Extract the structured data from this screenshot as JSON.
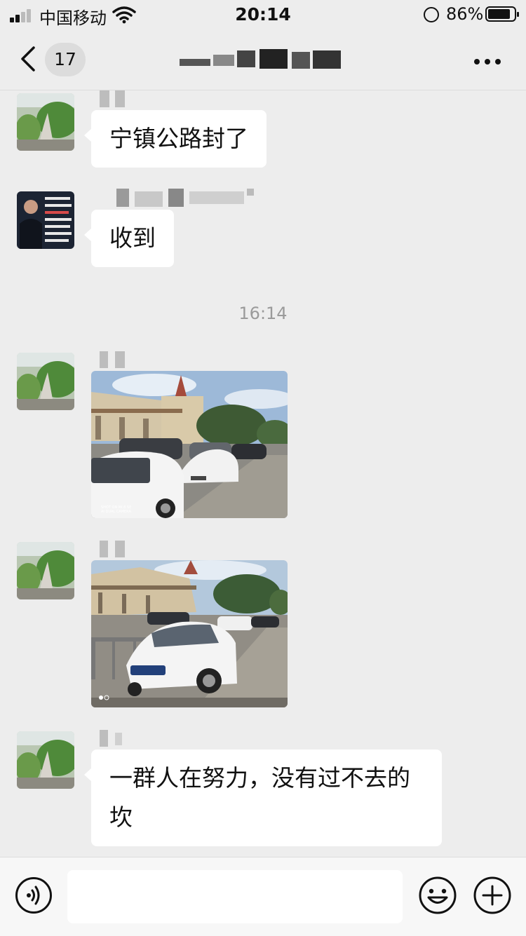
{
  "status_bar": {
    "carrier": "中国移动",
    "time": "20:14",
    "battery_percent": "86%",
    "battery_level": 0.86
  },
  "nav": {
    "unread_count": "17",
    "icons": [
      "chevron-left-icon",
      "more-icon"
    ]
  },
  "messages": [
    {
      "type": "text",
      "text": "宁镇公路封了"
    },
    {
      "type": "text",
      "text": "收到"
    },
    {
      "type": "time",
      "text": "16:14"
    },
    {
      "type": "image"
    },
    {
      "type": "image"
    },
    {
      "type": "text",
      "text": "一群人在努力，没有过不去的坎"
    }
  ],
  "photo_watermark_1": "SHOT ON MI 8 SE\nAI DUAL CAMERA",
  "input_bar": {
    "icons": [
      "voice-icon",
      "emoji-icon",
      "add-icon"
    ]
  },
  "colors": {
    "background": "#ededed",
    "bubble": "#ffffff",
    "timestamp": "#9a9a9a"
  }
}
